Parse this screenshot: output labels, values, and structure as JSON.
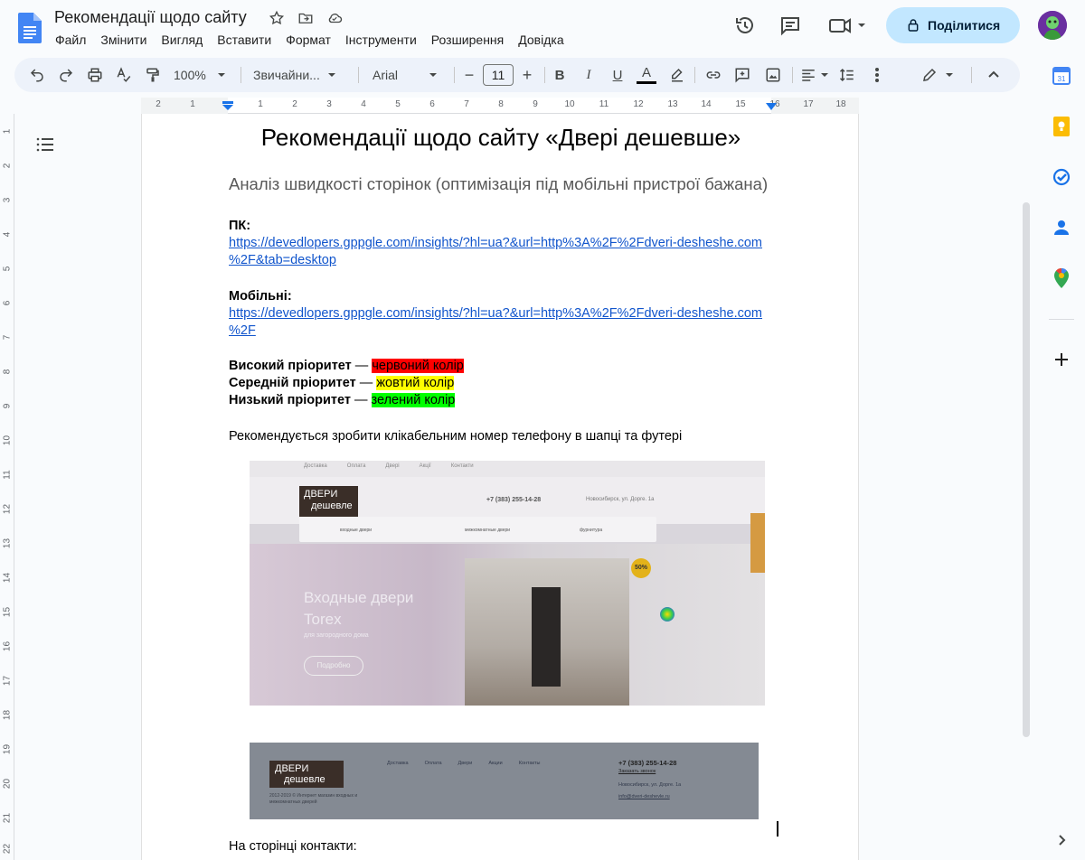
{
  "doc": {
    "title": "Рекомендації щодо сайту"
  },
  "menu": [
    "Файл",
    "Змінити",
    "Вигляд",
    "Вставити",
    "Формат",
    "Інструменти",
    "Розширення",
    "Довідка"
  ],
  "share": {
    "label": "Поділитися"
  },
  "toolbar": {
    "zoom": "100%",
    "style": "Звичайни...",
    "font": "Arial",
    "font_size": "11",
    "minus": "−",
    "plus": "+",
    "bold": "B",
    "italic": "I",
    "underline": "U",
    "text_color": "A"
  },
  "ruler": {
    "h_ticks": [
      "2",
      "1",
      "1",
      "2",
      "3",
      "4",
      "5",
      "6",
      "7",
      "8",
      "9",
      "10",
      "11",
      "12",
      "13",
      "14",
      "15",
      "16",
      "17",
      "18"
    ],
    "v_ticks": [
      "1",
      "2",
      "3",
      "4",
      "5",
      "6",
      "7",
      "8",
      "9",
      "10",
      "11",
      "12",
      "13",
      "14",
      "15",
      "16",
      "17",
      "18",
      "19",
      "20",
      "21",
      "22"
    ]
  },
  "content": {
    "heading": "Рекомендації щодо сайту «Двері дешевше»",
    "subtitle": "Аналіз швидкості сторінок (оптимізація під мобільні пристрої бажана)",
    "pc_label": "ПК:",
    "pc_link_line1": "https://devedlopers.gppgle.com/insights/?hl=ua?&url=http%3A%2F%2Fdveri-desheshe.com",
    "pc_link_line2": "%2F&tab=desktop",
    "mobile_label": "Мобільні:",
    "mobile_link_line1": "https://devedlopers.gppgle.com/insights/?hl=ua?&url=http%3A%2F%2Fdveri-desheshe.com",
    "mobile_link_line2": "%2F",
    "priority_high_label": "Високий пріоритет",
    "priority_high_value": "червоний колір",
    "priority_mid_label": "Середній пріоритет",
    "priority_mid_value": "жовтий колір",
    "priority_low_label": "Низький пріоритет",
    "priority_low_value": "зелений колір",
    "dash": " — ",
    "recommend_text": "Рекомендується зробити клікабельним номер телефону в шапці та футері",
    "contacts_text": "На сторінці контакти:"
  },
  "screenshot1": {
    "nav": [
      "Доставка",
      "Оплата",
      "Двері",
      "Акції",
      "Контакти"
    ],
    "logo_top": "ДВЕРИ",
    "logo_bottom": "дешевле",
    "phone": "+7 (383) 255-14-28",
    "address": "Новосибирск, ул. Дорге. 1а",
    "menu": [
      "входные двери",
      "межкомнатные двери",
      "фурнитура"
    ],
    "hero_title_1": "Входные двери",
    "hero_title_2": "Torex",
    "hero_sub": "для загородного дома",
    "hero_btn": "Подробно",
    "badge": "50%"
  },
  "screenshot2": {
    "logo_top": "ДВЕРИ",
    "logo_bottom": "дешевле",
    "copyright": "2012-2019 © Интернет магазин входных и межкомнатных дверей",
    "nav": [
      "Доставка",
      "Оплата",
      "Двери",
      "Акции",
      "Контакты"
    ],
    "phone": "+7 (383) 255-14-28",
    "callback": "Заказать звонок",
    "address": "Новосибирск, ул. Дорге. 1а",
    "email": "info@dveri-deshevle.ru"
  },
  "colors": {
    "accent": "#c2e7ff",
    "link": "#1155cc",
    "toolbar_bg": "#edf2fa"
  }
}
